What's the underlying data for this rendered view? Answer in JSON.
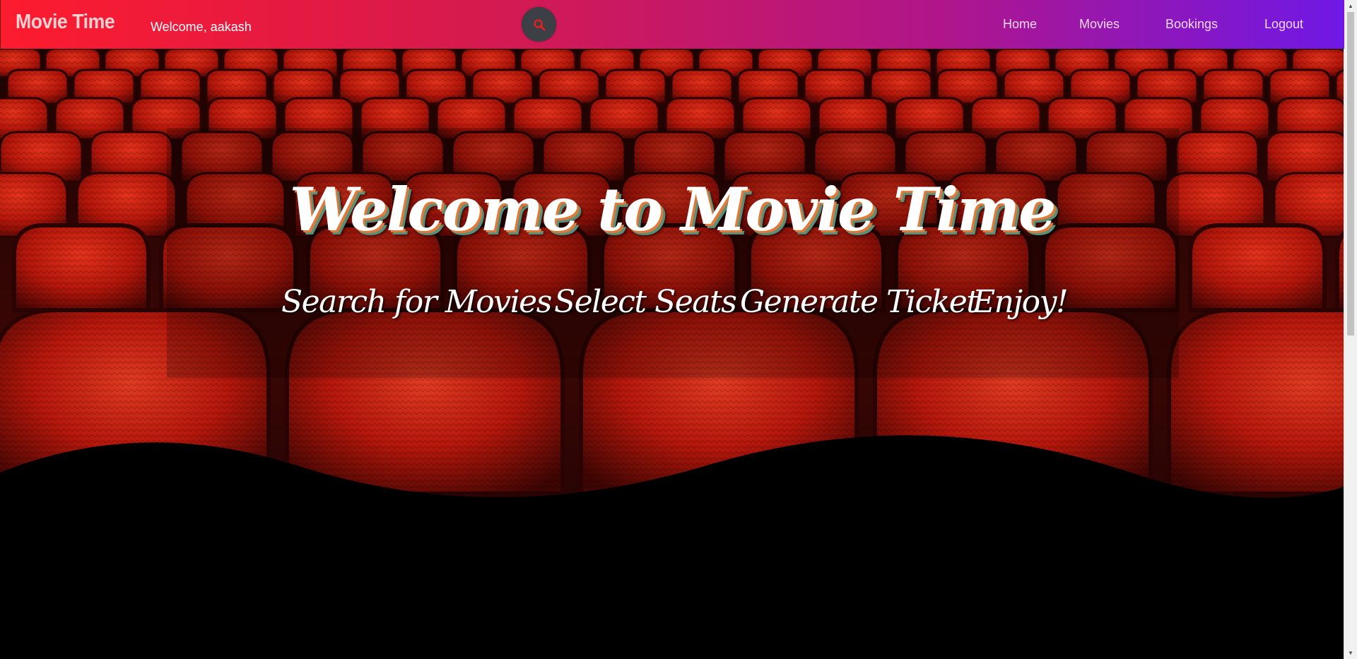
{
  "navbar": {
    "brand": "Movie Time",
    "welcome_text": "Welcome, aakash",
    "search_icon": "search-icon",
    "links": [
      {
        "label": "Home"
      },
      {
        "label": "Movies"
      },
      {
        "label": "Bookings"
      },
      {
        "label": "Logout"
      }
    ]
  },
  "hero": {
    "title": "Welcome to Movie Time",
    "background": "red-cinema-seats-image",
    "steps": [
      {
        "label": "Search for Movies"
      },
      {
        "label": "Select Seats"
      },
      {
        "label": "Generate Ticket"
      },
      {
        "label": "Enjoy!"
      }
    ]
  },
  "colors": {
    "navbar_gradient_start": "#fd1b2e",
    "navbar_gradient_end": "#6f18e6",
    "search_button": "#3c3f45",
    "search_icon": "#e02020",
    "seat_red": "#b3160a",
    "title_shadow_orange": "#e07a3a",
    "title_shadow_green": "#5a8f7a"
  }
}
